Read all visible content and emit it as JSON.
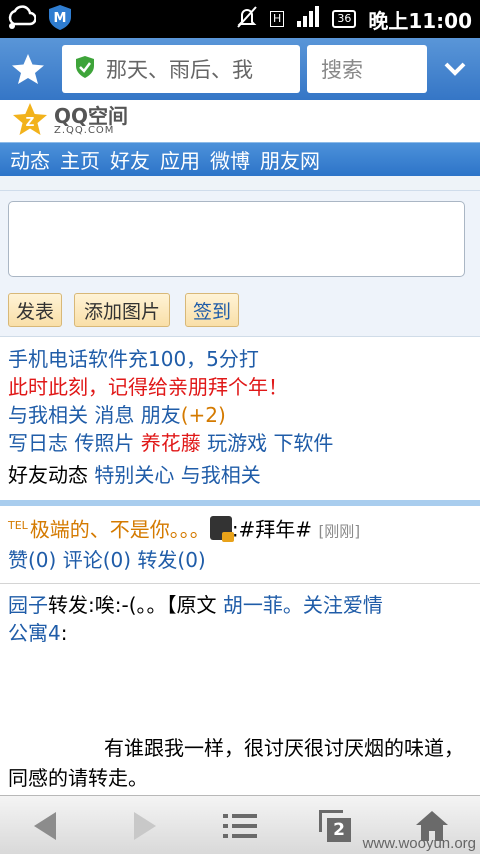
{
  "status_bar": {
    "time": "晚上11:00",
    "battery": "36",
    "network": "H"
  },
  "toolbar": {
    "url_text": "那天、雨后、我",
    "search_placeholder": "搜索"
  },
  "logo": {
    "main": "QQ空间",
    "sub": "Z.QQ.COM"
  },
  "nav": [
    "动态",
    "主页",
    "好友",
    "应用",
    "微博",
    "朋友网"
  ],
  "composer": {
    "post_button": "发表",
    "add_image_button": "添加图片",
    "checkin_button": "签到"
  },
  "links": {
    "promo1": "手机电话软件充100，5分打",
    "promo2": "此时此刻，记得给亲朋拜个年！",
    "related": "与我相关",
    "messages": "消息",
    "friends": "朋友",
    "friends_count": "(+2)",
    "diary": "写日志",
    "photos": "传照片",
    "garden": "养花藤",
    "games": "玩游戏",
    "software": "下软件"
  },
  "feed_tabs": {
    "label": "好友动态",
    "special": "特别关心",
    "related": "与我相关"
  },
  "feed1": {
    "tel_badge": "TEL",
    "user": "极端的、不是你。。。",
    "content": ":#拜年#",
    "time": "[刚刚]",
    "like": "赞(0)",
    "comment": "评论(0)",
    "forward": "转发(0)"
  },
  "feed2": {
    "user": "园子",
    "action": "转发:唉:-(。。【原文",
    "original_author": "胡一菲。关注爱情",
    "original_author2": "公寓4",
    "colon": ":",
    "body": "有谁跟我一样，很讨厌很讨厌烟的味道，同感的请转走。"
  },
  "bottom_bar": {
    "tabs_count": "2"
  },
  "watermark": "www.wooyun.org"
}
